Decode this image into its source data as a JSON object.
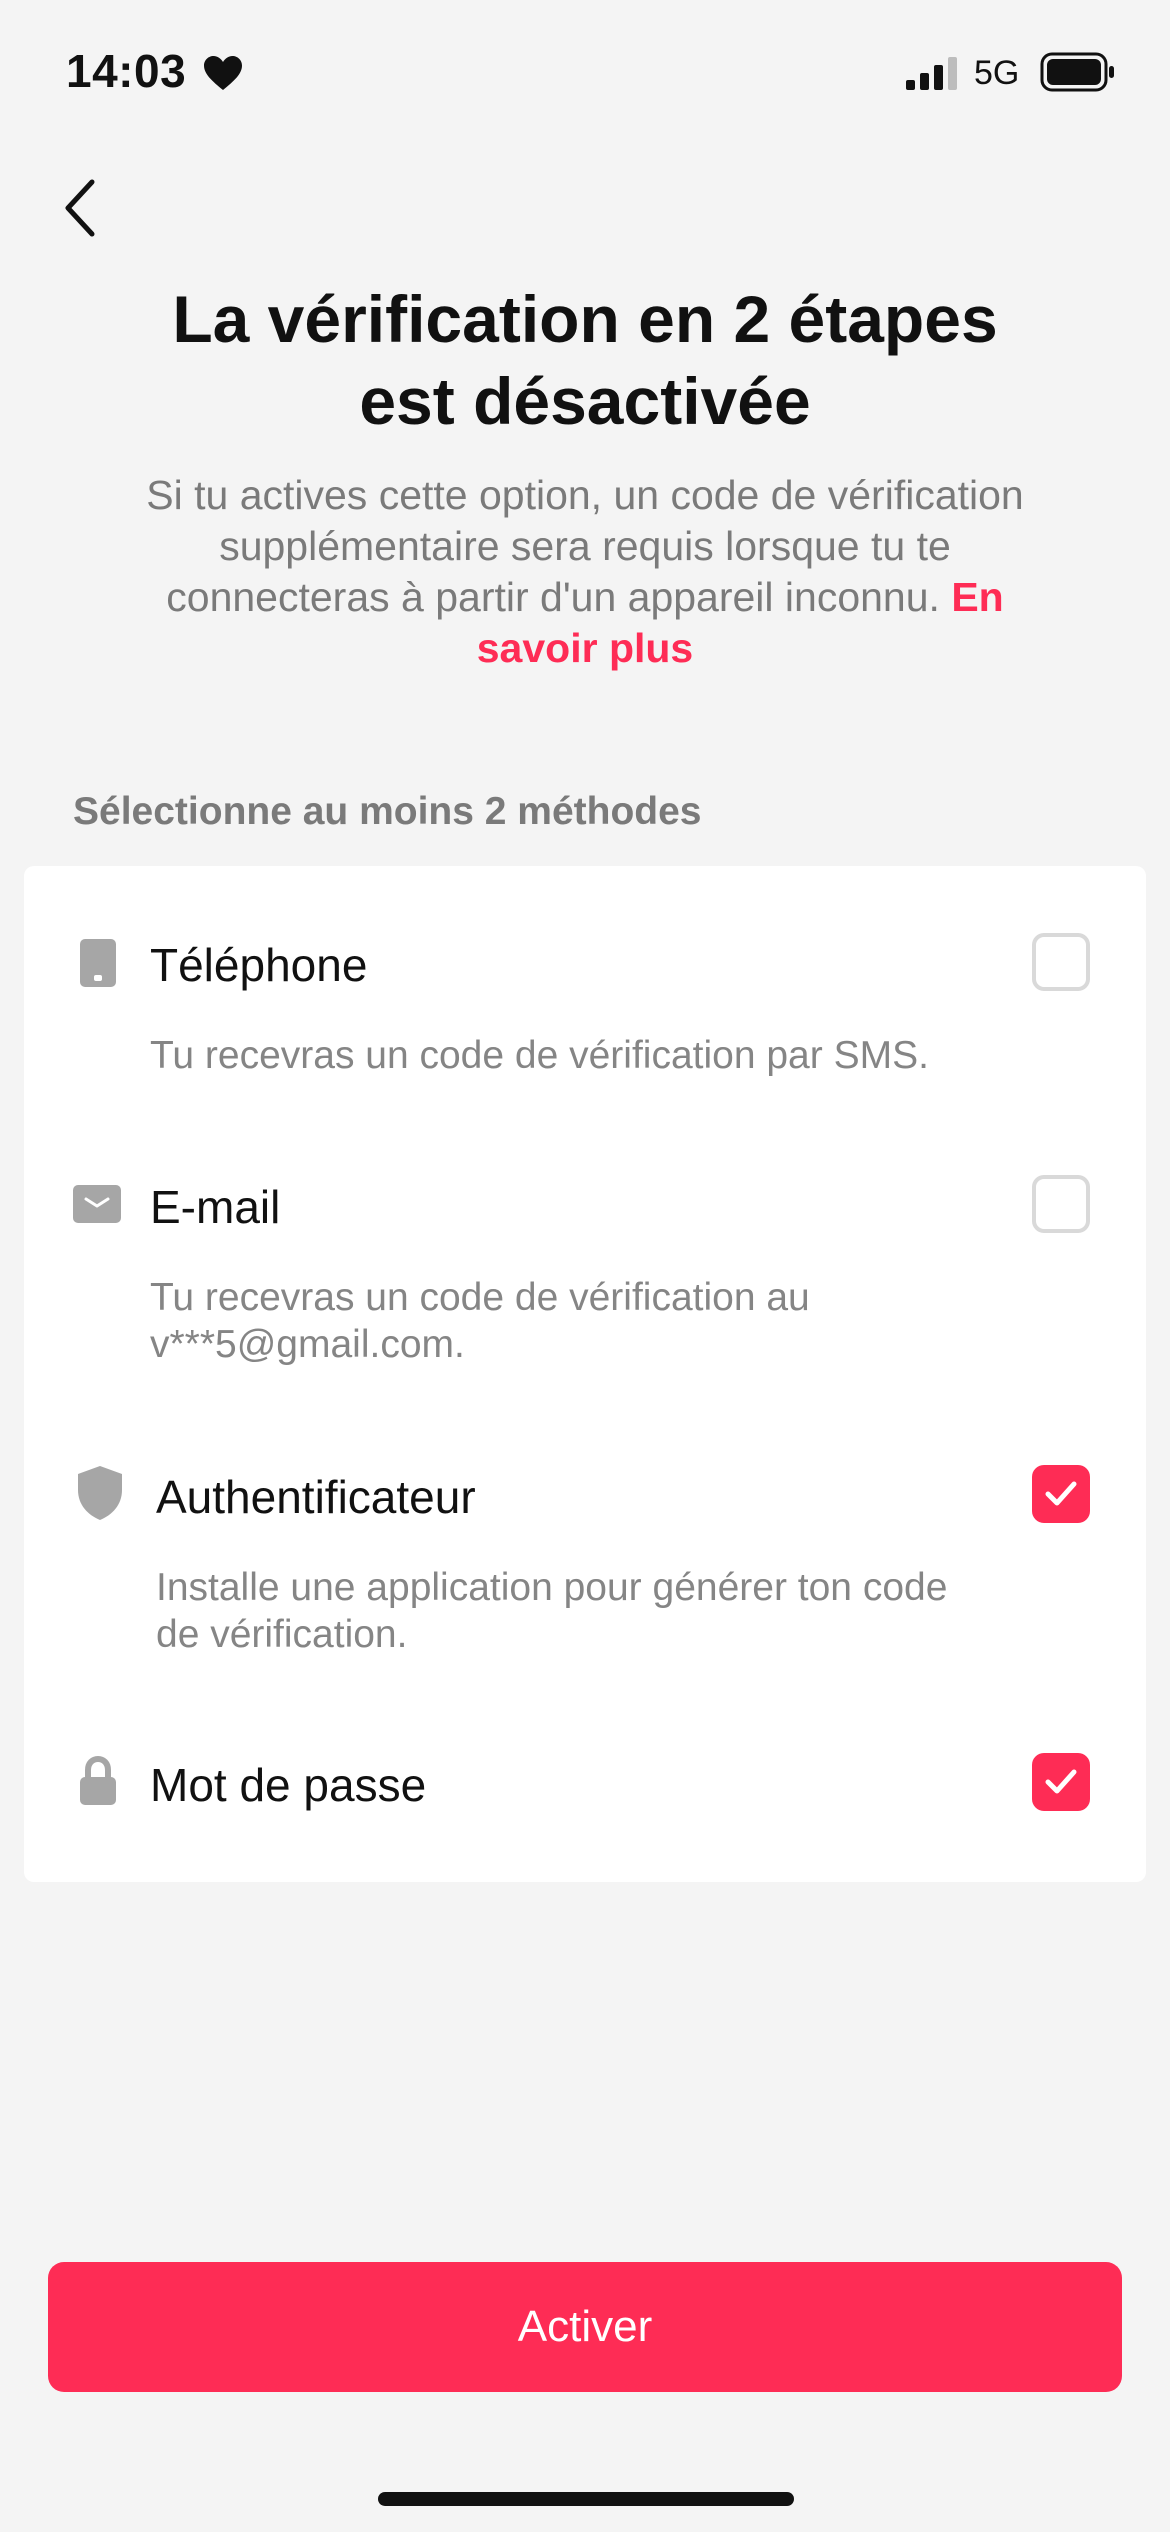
{
  "status_bar": {
    "time": "14:03",
    "network": "5G"
  },
  "header": {
    "title_line1": "La vérification en 2 étapes",
    "title_line2": "est désactivée",
    "description": "Si tu actives cette option, un code de vérification supplémentaire sera requis lorsque tu te connecteras à partir d'un appareil inconnu.",
    "learn_more": "En savoir plus"
  },
  "section_label": "Sélectionne au moins 2 méthodes",
  "methods": [
    {
      "icon": "phone-icon",
      "title": "Téléphone",
      "description_line1": "Tu recevras un code de vérification par SMS.",
      "checked": false
    },
    {
      "icon": "mail-icon",
      "title": "E-mail",
      "description_line1": "Tu recevras un code de vérification au",
      "description_line2": "v***5@gmail.com.",
      "checked": false
    },
    {
      "icon": "shield-icon",
      "title": "Authentificateur",
      "description_line1": "Installe une application pour générer ton code",
      "description_line2": "de vérification.",
      "checked": true
    },
    {
      "icon": "lock-icon",
      "title": "Mot de passe",
      "checked": true
    }
  ],
  "activate_button": "Activer",
  "colors": {
    "accent": "#fe2c55",
    "background": "#f4f4f4",
    "card": "#ffffff",
    "muted_text": "#7a7a7a",
    "icon": "#a6a6a6"
  }
}
